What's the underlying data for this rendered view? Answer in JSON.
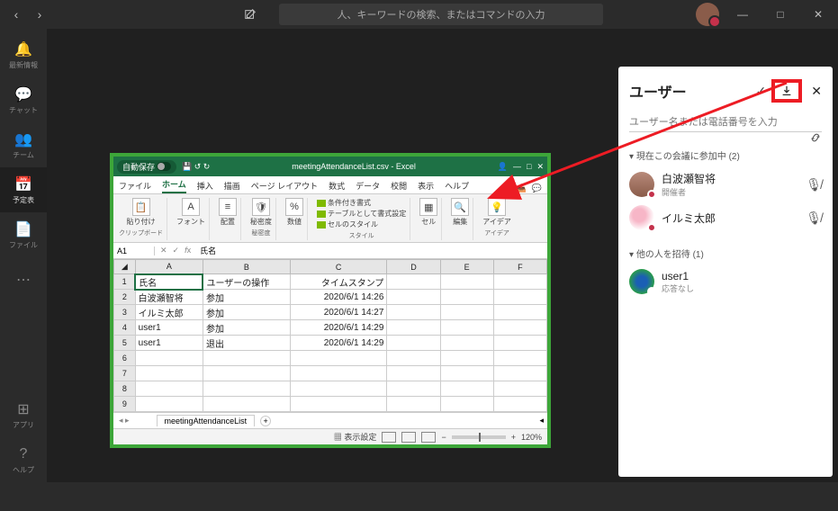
{
  "titlebar": {
    "search_placeholder": "人、キーワードの検索、またはコマンドの入力"
  },
  "rail": {
    "items": [
      {
        "label": "最新情報"
      },
      {
        "label": "チャット"
      },
      {
        "label": "チーム"
      },
      {
        "label": "予定表"
      },
      {
        "label": "ファイル"
      },
      {
        "label": "…"
      }
    ],
    "bottom": [
      {
        "label": "アプリ"
      },
      {
        "label": "ヘルプ"
      }
    ]
  },
  "rightpanel": {
    "title": "ユーザー",
    "input_placeholder": "ユーザー名または電話番号を入力",
    "section_current": "現在この会議に参加中 (2)",
    "section_invite": "他の人を招待 (1)",
    "p1_name": "白波瀬智将",
    "p1_role": "開催者",
    "p2_name": "イルミ太郎",
    "p3_name": "user1",
    "p3_role": "応答なし"
  },
  "excel": {
    "autosave": "自動保存",
    "filename": "meetingAttendanceList.csv - Excel",
    "tabs": {
      "file": "ファイル",
      "home": "ホーム",
      "insert": "挿入",
      "draw": "描画",
      "layout": "ページ レイアウト",
      "formula": "数式",
      "data": "データ",
      "review": "校閲",
      "view": "表示",
      "help": "ヘルプ"
    },
    "ribbon": {
      "paste": "貼り付け",
      "clipboard": "クリップボード",
      "font": "フォント",
      "align": "配置",
      "sens": "秘密度",
      "sens_g": "秘密度",
      "num": "数値",
      "cond": "条件付き書式",
      "table": "テーブルとして書式設定",
      "cellstyle": "セルのスタイル",
      "style": "スタイル",
      "cell": "セル",
      "edit": "編集",
      "idea": "アイデア",
      "idea_g": "アイデア"
    },
    "cellref": "A1",
    "fxval": "氏名",
    "cols": [
      "A",
      "B",
      "C",
      "D",
      "E",
      "F"
    ],
    "rows": [
      {
        "n": "1",
        "a": "氏名",
        "b": "ユーザーの操作",
        "c": "タイムスタンプ"
      },
      {
        "n": "2",
        "a": "白波瀬智将",
        "b": "参加",
        "c": "2020/6/1 14:26"
      },
      {
        "n": "3",
        "a": "イルミ太郎",
        "b": "参加",
        "c": "2020/6/1 14:27"
      },
      {
        "n": "4",
        "a": "user1",
        "b": "参加",
        "c": "2020/6/1 14:29"
      },
      {
        "n": "5",
        "a": "user1",
        "b": "退出",
        "c": "2020/6/1 14:29"
      },
      {
        "n": "6",
        "a": "",
        "b": "",
        "c": ""
      },
      {
        "n": "7",
        "a": "",
        "b": "",
        "c": ""
      },
      {
        "n": "8",
        "a": "",
        "b": "",
        "c": ""
      },
      {
        "n": "9",
        "a": "",
        "b": "",
        "c": ""
      }
    ],
    "sheet": "meetingAttendanceList",
    "dispset": "表示設定",
    "zoom": "120%"
  }
}
